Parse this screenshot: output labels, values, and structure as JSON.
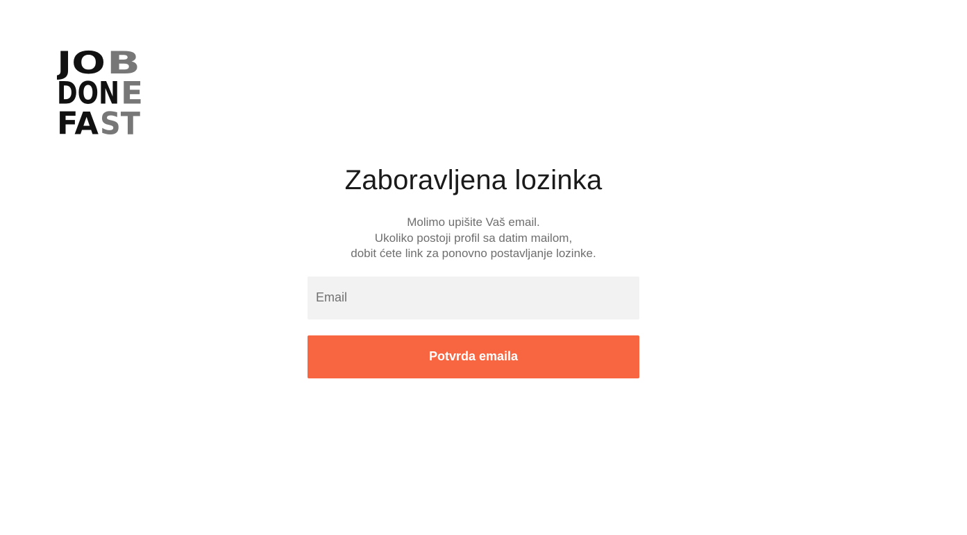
{
  "logo": {
    "lines": [
      {
        "dark": "JO",
        "light": "B"
      },
      {
        "dark": "DON",
        "light": "E"
      },
      {
        "dark": "FA",
        "light": "ST"
      }
    ],
    "colors": {
      "dark": "#111111",
      "light": "#777777"
    }
  },
  "title": "Zaboravljena lozinka",
  "description": [
    "Molimo upišite Vaš email.",
    "Ukoliko postoji profil sa datim mailom,",
    "dobit ćete link za ponovno postavljanje lozinke."
  ],
  "email_input": {
    "placeholder": "Email",
    "value": ""
  },
  "submit_button": {
    "label": "Potvrda emaila",
    "color": "#f76641"
  }
}
